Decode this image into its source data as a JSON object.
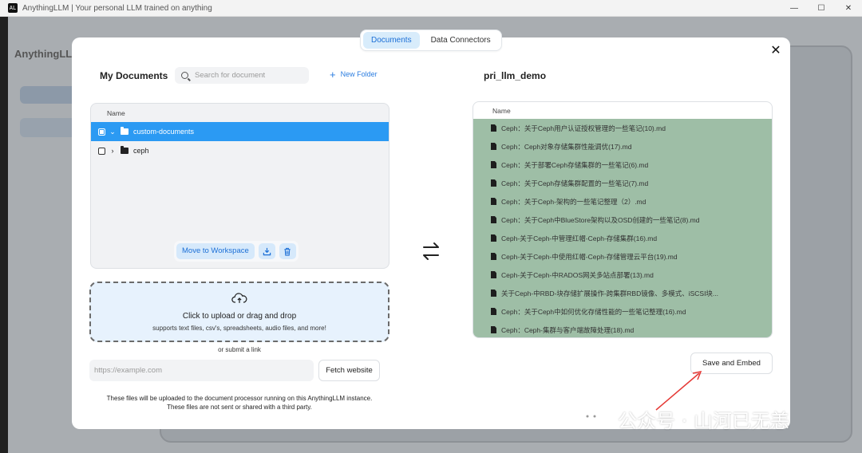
{
  "window": {
    "title": "AnythingLLM | Your personal LLM trained on anything",
    "controls": [
      "—",
      "☐",
      "✕"
    ]
  },
  "background_app": {
    "brand": "AnythingLLM"
  },
  "tabs": [
    {
      "label": "Documents",
      "active": true
    },
    {
      "label": "Data Connectors",
      "active": false
    }
  ],
  "my_documents": {
    "heading": "My Documents",
    "search_placeholder": "Search for document",
    "new_folder": "New Folder",
    "column_name": "Name",
    "rows": [
      {
        "label": "custom-documents",
        "selected": true,
        "expanded": true
      },
      {
        "label": "ceph",
        "selected": false,
        "expanded": false
      }
    ],
    "move_button": "Move to Workspace"
  },
  "upload": {
    "title": "Click to upload or drag and drop",
    "subtitle": "supports text files, csv's, spreadsheets, audio files, and more!",
    "or_link": "or submit a link",
    "url_placeholder": "https://example.com",
    "fetch_button": "Fetch website",
    "disclaimer_1": "These files will be uploaded to the document processor running on this AnythingLLM instance.",
    "disclaimer_2": "These files are not sent or shared with a third party."
  },
  "workspace": {
    "heading": "pri_llm_demo",
    "column_name": "Name",
    "files": [
      "Ceph：关于Ceph用户认证授权管理的一些笔记(10).md",
      "Ceph：Ceph对象存储集群性能调优(17).md",
      "Ceph：关于部署Ceph存储集群的一些笔记(6).md",
      "Ceph：关于Ceph存储集群配置的一些笔记(7).md",
      "Ceph：关于Ceph-架构的一些笔记整理（2）.md",
      "Ceph：关于Ceph中BlueStore架构以及OSD创建的一些笔记(8).md",
      "Ceph-关于Ceph-中管理红帽-Ceph-存储集群(16).md",
      "Ceph-关于Ceph-中使用红帽-Ceph-存储管理云平台(19).md",
      "Ceph-关于Ceph-中RADOS网关多站点部署(13).md",
      "关于Ceph-中RBD-块存储扩展操作-跨集群RBD镜像、多模式、iSCSI块...",
      "Ceph：关于Ceph中如何优化存储性能的一些笔记整理(16).md",
      "Ceph：Ceph-集群与客户端故障处理(18).md"
    ],
    "save_button": "Save and Embed"
  },
  "watermark": {
    "text": "公众号 · 山河已无恙"
  },
  "colors": {
    "accent": "#2b9af3",
    "tab_active_bg": "#d8ecfb",
    "embedded_bg": "#9ebea6",
    "annotation_arrow": "#e53935"
  }
}
